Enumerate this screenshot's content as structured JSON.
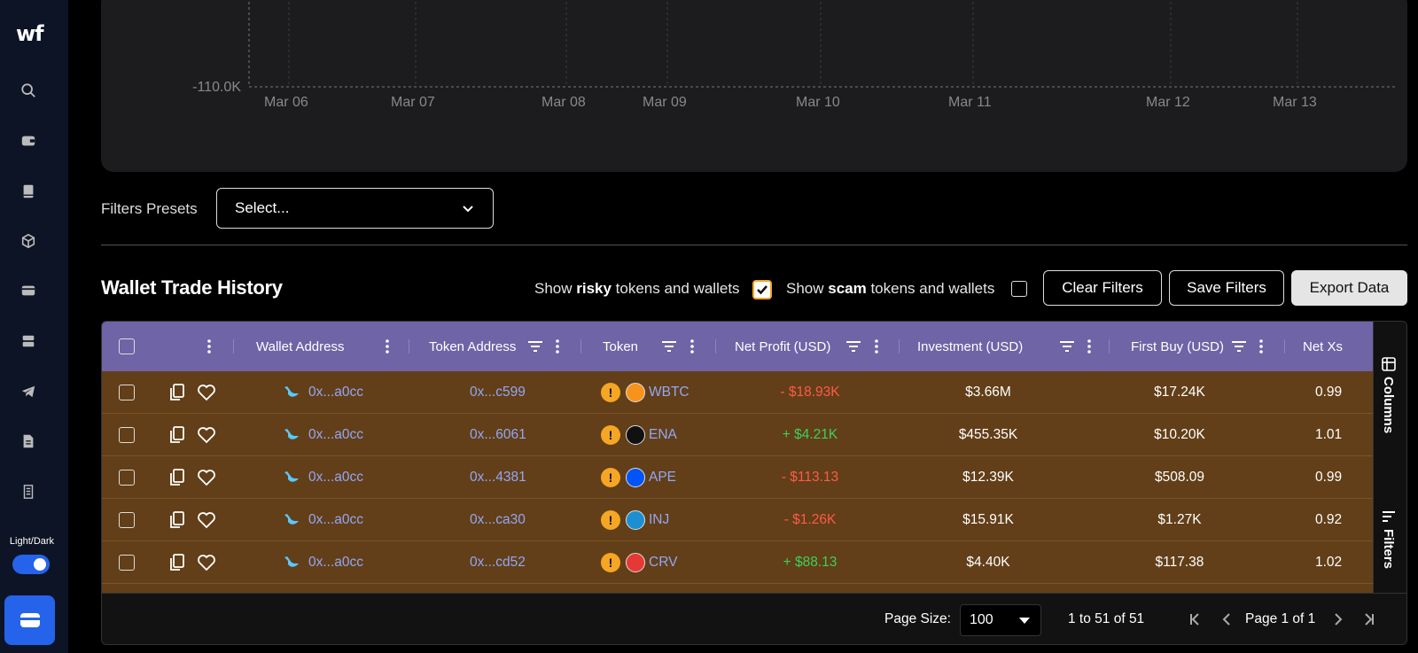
{
  "sidebar": {
    "logo": "wf",
    "theme_label": "Light/Dark",
    "icons": [
      "search-icon",
      "wallet-icon",
      "book-icon",
      "cube-icon",
      "card-icon",
      "server-icon",
      "telegram-icon",
      "document-icon",
      "receipt-icon"
    ]
  },
  "chart": {
    "y_labels": [
      "-110.0K"
    ],
    "x_labels": [
      "Mar 06",
      "Mar 07",
      "Mar 08",
      "Mar 09",
      "Mar 10",
      "Mar 11",
      "Mar 12",
      "Mar 13"
    ]
  },
  "filters": {
    "presets_label": "Filters Presets",
    "presets_placeholder": "Select..."
  },
  "section": {
    "title": "Wallet Trade History",
    "risky_pre": "Show ",
    "risky_bold": "risky",
    "risky_post": " tokens and wallets",
    "risky_checked": true,
    "scam_pre": "Show ",
    "scam_bold": "scam",
    "scam_post": " tokens and wallets",
    "scam_checked": false,
    "clear_filters": "Clear Filters",
    "save_filters": "Save Filters",
    "export_data": "Export Data"
  },
  "table": {
    "columns": [
      "Wallet Address",
      "Token Address",
      "Token",
      "Net Profit (USD)",
      "Investment (USD)",
      "First Buy (USD)",
      "Net Xs"
    ],
    "rows": [
      {
        "wallet": "0x...a0cc",
        "token_address": "0x...c599",
        "token": "WBTC",
        "token_icon_color": "#f7931a",
        "net_profit": "- $18.93K",
        "profit_sign": "neg",
        "investment": "$3.66M",
        "first_buy": "$17.24K",
        "net_xs": "0.99"
      },
      {
        "wallet": "0x...a0cc",
        "token_address": "0x...6061",
        "token": "ENA",
        "token_icon_color": "#111111",
        "net_profit": "+ $4.21K",
        "profit_sign": "pos",
        "investment": "$455.35K",
        "first_buy": "$10.20K",
        "net_xs": "1.01"
      },
      {
        "wallet": "0x...a0cc",
        "token_address": "0x...4381",
        "token": "APE",
        "token_icon_color": "#0054f9",
        "net_profit": "- $113.13",
        "profit_sign": "neg",
        "investment": "$12.39K",
        "first_buy": "$508.09",
        "net_xs": "0.99"
      },
      {
        "wallet": "0x...a0cc",
        "token_address": "0x...ca30",
        "token": "INJ",
        "token_icon_color": "#1b8fd2",
        "net_profit": "- $1.26K",
        "profit_sign": "neg",
        "investment": "$15.91K",
        "first_buy": "$1.27K",
        "net_xs": "0.92"
      },
      {
        "wallet": "0x...a0cc",
        "token_address": "0x...cd52",
        "token": "CRV",
        "token_icon_color": "#e53935",
        "net_profit": "+ $88.13",
        "profit_sign": "pos",
        "investment": "$4.40K",
        "first_buy": "$117.38",
        "net_xs": "1.02"
      }
    ],
    "side_columns": "Columns",
    "side_filters": "Filters"
  },
  "pager": {
    "page_size_label": "Page Size:",
    "page_size": "100",
    "range": "1 to 51 of 51",
    "page_info": "Page 1 of 1"
  }
}
